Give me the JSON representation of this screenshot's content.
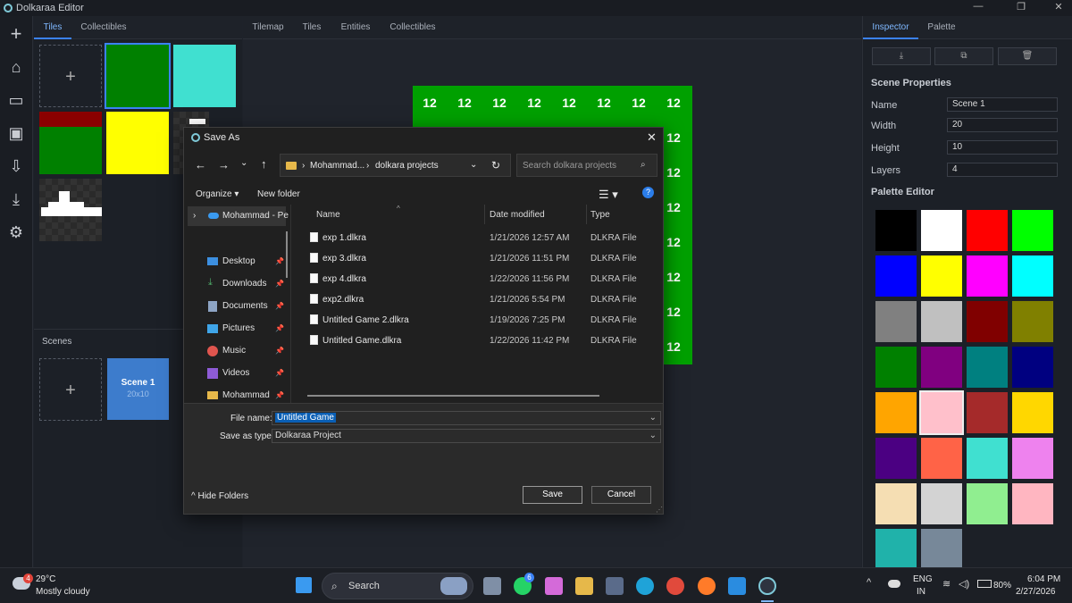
{
  "app": {
    "title": "Dolkaraa Editor"
  },
  "left_tabs": [
    "Tiles",
    "Collectibles"
  ],
  "center_tabs": [
    "Tilemap",
    "Tiles",
    "Entities",
    "Collectibles"
  ],
  "right_tabs": [
    "Inspector",
    "Palette"
  ],
  "tiles": {
    "add_symbol": "+"
  },
  "scenes": {
    "header": "Scenes",
    "add_symbol": "+",
    "items": [
      {
        "name": "Scene 1",
        "size": "20x10"
      }
    ]
  },
  "tilemap": {
    "cell_value": "12"
  },
  "inspector": {
    "section_title": "Scene Properties",
    "props": [
      {
        "label": "Name",
        "value": "Scene 1"
      },
      {
        "label": "Width",
        "value": "20"
      },
      {
        "label": "Height",
        "value": "10"
      },
      {
        "label": "Layers",
        "value": "4"
      }
    ],
    "palette_title": "Palette Editor",
    "palette_colors": [
      "#000000",
      "#ffffff",
      "#ff0000",
      "#00ff00",
      "#0000ff",
      "#ffff00",
      "#ff00ff",
      "#00ffff",
      "#808080",
      "#c0c0c0",
      "#800000",
      "#808000",
      "#008000",
      "#800080",
      "#008080",
      "#000080",
      "#ffa500",
      "#ffc0cb",
      "#a52a2a",
      "#ffd700",
      "#4b0082",
      "#ff6347",
      "#40e0d0",
      "#ee82ee",
      "#f5deb3",
      "#d3d3d3",
      "#90ee90",
      "#ffb6c1",
      "#20b2aa",
      "#778899"
    ]
  },
  "dialog": {
    "title": "Save As",
    "breadcrumb_1": "Mohammad...",
    "breadcrumb_2": "dolkara projects",
    "search_placeholder": "Search dolkara projects",
    "organize": "Organize",
    "new_folder": "New folder",
    "nav": [
      "Mohammad - Pe",
      "Desktop",
      "Downloads",
      "Documents",
      "Pictures",
      "Music",
      "Videos",
      "Mohammad"
    ],
    "columns": [
      "Name",
      "Date modified",
      "Type"
    ],
    "files": [
      {
        "name": "exp 1.dlkra",
        "date": "1/21/2026 12:57 AM",
        "type": "DLKRA File"
      },
      {
        "name": "exp 3.dlkra",
        "date": "1/21/2026 11:51 PM",
        "type": "DLKRA File"
      },
      {
        "name": "exp 4.dlkra",
        "date": "1/22/2026 11:56 PM",
        "type": "DLKRA File"
      },
      {
        "name": "exp2.dlkra",
        "date": "1/21/2026 5:54 PM",
        "type": "DLKRA File"
      },
      {
        "name": "Untitled Game 2.dlkra",
        "date": "1/19/2026 7:25 PM",
        "type": "DLKRA File"
      },
      {
        "name": "Untitled Game.dlkra",
        "date": "1/22/2026 11:42 PM",
        "type": "DLKRA File"
      }
    ],
    "file_name_label": "File name:",
    "file_name_value": "Untitled Game",
    "save_type_label": "Save as type:",
    "save_type_value": "Dolkaraa Project",
    "hide_folders": "Hide Folders",
    "save": "Save",
    "cancel": "Cancel"
  },
  "taskbar": {
    "weather_temp": "29°C",
    "weather_desc": "Mostly cloudy",
    "weather_badge": "4",
    "search": "Search",
    "whatsapp_badge": "6",
    "lang": "ENG",
    "region": "IN",
    "battery": "80%",
    "time": "6:04 PM",
    "date": "2/27/2026"
  }
}
